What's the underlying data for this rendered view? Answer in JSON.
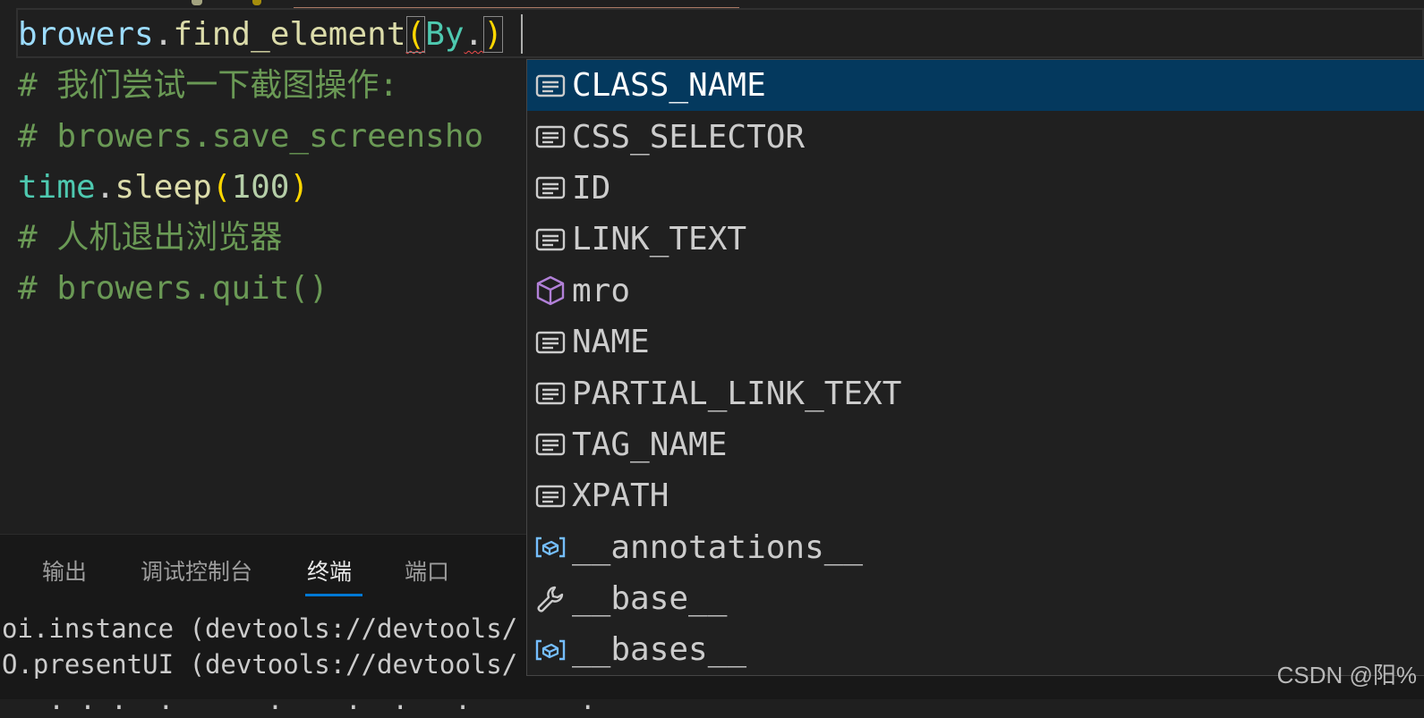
{
  "editor": {
    "line1": {
      "object": "browers",
      "dot": ".",
      "method": "find_element",
      "open_paren": "(",
      "arg_class": "By",
      "arg_dot": ".",
      "close_paren": ")"
    },
    "line2_comment": "# 我们尝试一下截图操作:",
    "line3_comment": "# browers.save_screensho",
    "line4": {
      "module": "time",
      "dot": ".",
      "method": "sleep",
      "open_paren": "(",
      "number": "100",
      "close_paren": ")"
    },
    "line5_comment": "# 人机退出浏览器",
    "line6_comment": "# browers.quit()"
  },
  "suggestions": {
    "items": [
      {
        "label": "CLASS_NAME",
        "icon": "enum-member-icon",
        "selected": true
      },
      {
        "label": "CSS_SELECTOR",
        "icon": "enum-member-icon"
      },
      {
        "label": "ID",
        "icon": "enum-member-icon"
      },
      {
        "label": "LINK_TEXT",
        "icon": "enum-member-icon"
      },
      {
        "label": "mro",
        "icon": "method-cube-icon"
      },
      {
        "label": "NAME",
        "icon": "enum-member-icon"
      },
      {
        "label": "PARTIAL_LINK_TEXT",
        "icon": "enum-member-icon"
      },
      {
        "label": "TAG_NAME",
        "icon": "enum-member-icon"
      },
      {
        "label": "XPATH",
        "icon": "enum-member-icon"
      },
      {
        "label": "__annotations__",
        "icon": "variable-icon"
      },
      {
        "label": "__base__",
        "icon": "wrench-icon"
      },
      {
        "label": "__bases__",
        "icon": "variable-icon"
      }
    ]
  },
  "panel": {
    "tabs": [
      {
        "label": "输出"
      },
      {
        "label": "调试控制台"
      },
      {
        "label": "终端",
        "active": true
      },
      {
        "label": "端口"
      }
    ],
    "terminal_lines": [
      "oi.instance (devtools://devtools/",
      "O.presentUI (devtools://devtools/",
      "   . . .  .      .    .  .   .       ."
    ]
  },
  "watermark": "CSDN @阳%"
}
